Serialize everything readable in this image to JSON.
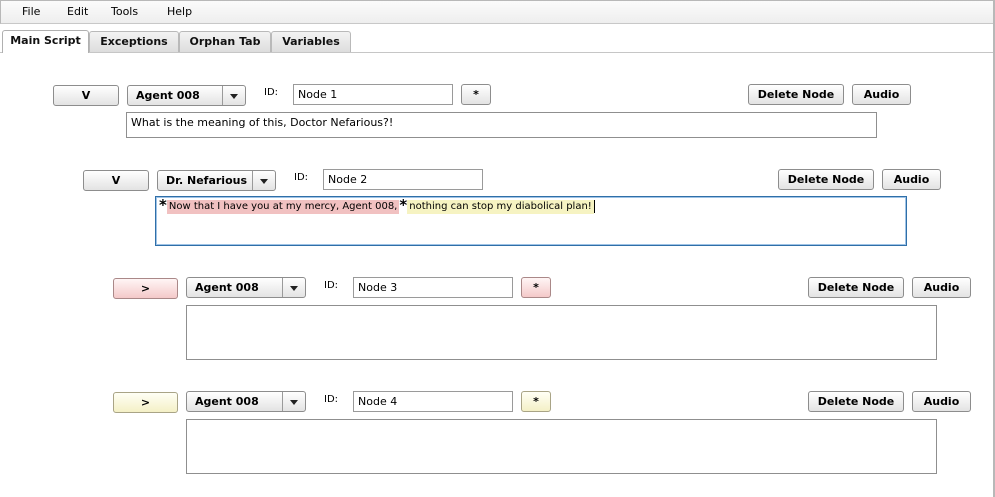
{
  "menu": {
    "file": "File",
    "edit": "Edit",
    "tools": "Tools",
    "help": "Help"
  },
  "tabs": [
    "Main Script",
    "Exceptions",
    "Orphan Tab",
    "Variables"
  ],
  "labels": {
    "id": "ID:",
    "delete": "Delete Node",
    "audio": "Audio",
    "star": "*"
  },
  "nodes": [
    {
      "toggle": "V",
      "speaker": "Agent 008",
      "id": "Node 1",
      "text": "What is the meaning of this, Doctor Nefarious?!"
    },
    {
      "toggle": "V",
      "speaker": "Dr. Nefarious",
      "id": "Node 2",
      "segments": [
        {
          "star": "*",
          "text": "Now that I have you at my mercy, Agent 008, ",
          "color": "#f1c1c1"
        },
        {
          "star": "*",
          "text": "nothing can stop my diabolical plan!",
          "color": "#f6f3c2"
        }
      ]
    },
    {
      "toggle": ">",
      "speaker": "Agent 008",
      "id": "Node 3",
      "text": "",
      "color": "#f4c9c9"
    },
    {
      "toggle": ">",
      "speaker": "Agent 008",
      "id": "Node 4",
      "text": "",
      "color": "#f4f0c6"
    }
  ]
}
